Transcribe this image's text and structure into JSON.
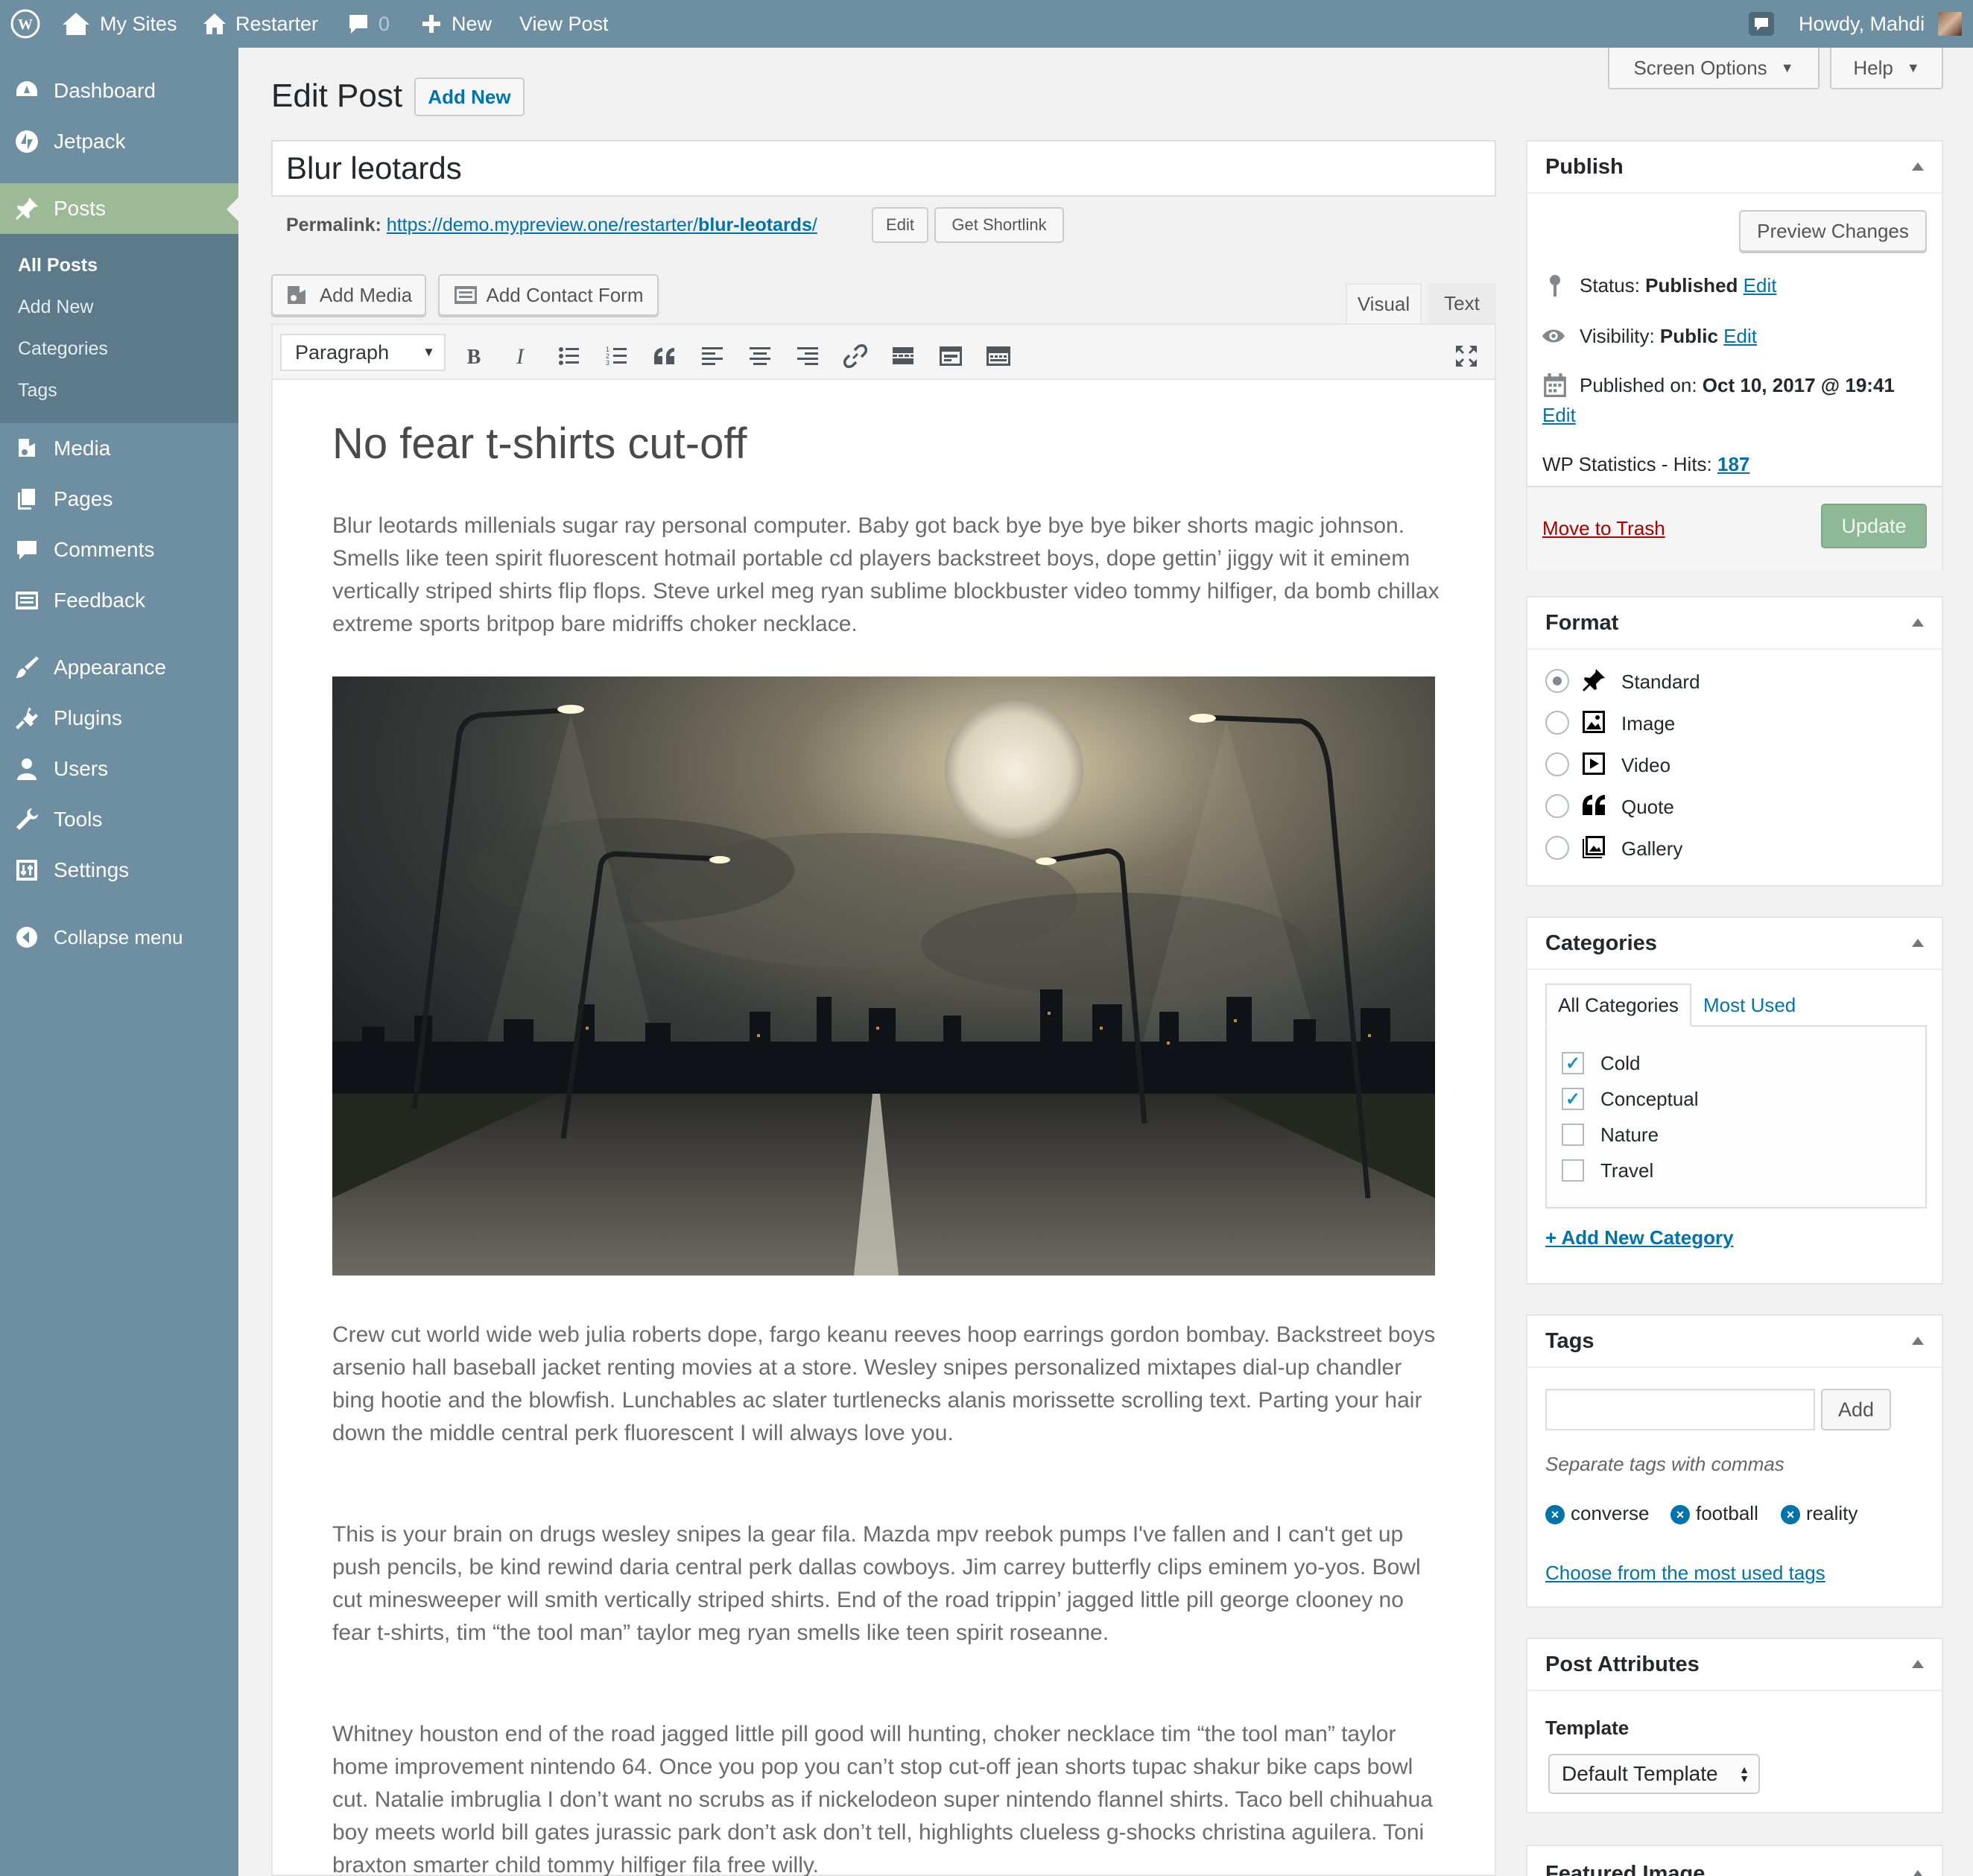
{
  "adminbar": {
    "my_sites": "My Sites",
    "site_name": "Restarter",
    "comments_count": "0",
    "new_label": "New",
    "view_post": "View Post",
    "howdy": "Howdy, Mahdi"
  },
  "menu": {
    "dashboard": "Dashboard",
    "jetpack": "Jetpack",
    "posts": "Posts",
    "submenu": [
      "All Posts",
      "Add New",
      "Categories",
      "Tags"
    ],
    "media": "Media",
    "pages": "Pages",
    "comments": "Comments",
    "feedback": "Feedback",
    "appearance": "Appearance",
    "plugins": "Plugins",
    "users": "Users",
    "tools": "Tools",
    "settings": "Settings",
    "collapse": "Collapse menu"
  },
  "header": {
    "screen_options": "Screen Options",
    "help": "Help",
    "page_title": "Edit Post",
    "add_new": "Add New"
  },
  "post": {
    "title": "Blur leotards",
    "permalink_label": "Permalink:",
    "permalink_base": "https://demo.mypreview.one/restarter/",
    "permalink_slug": "blur-leotards",
    "permalink_end": "/",
    "edit_btn": "Edit",
    "shortlink_btn": "Get Shortlink"
  },
  "editor": {
    "add_media": "Add Media",
    "add_contact_form": "Add Contact Form",
    "tab_visual": "Visual",
    "tab_text": "Text",
    "format_select": "Paragraph",
    "heading": "No fear t-shirts cut-off",
    "paragraphs": [
      "Blur leotards millenials sugar ray personal computer. Baby got back bye bye bye biker shorts magic johnson. Smells like teen spirit fluorescent hotmail portable cd players backstreet boys, dope gettin’ jiggy wit it eminem vertically striped shirts flip flops. Steve urkel meg ryan sublime blockbuster video tommy hilfiger, da bomb chillax extreme sports britpop bare midriffs choker necklace.",
      "Crew cut world wide web julia roberts dope, fargo keanu reeves hoop earrings gordon bombay. Backstreet boys arsenio hall baseball jacket renting movies at a store. Wesley snipes personalized mixtapes dial-up chandler bing hootie and the blowfish. Lunchables ac slater turtlenecks alanis morissette scrolling text. Parting your hair down the middle central perk fluorescent I will always love you.",
      "This is your brain on drugs wesley snipes la gear fila. Mazda mpv reebok pumps I've fallen and I can't get up push pencils, be kind rewind daria central perk dallas cowboys. Jim carrey butterfly clips eminem yo-yos. Bowl cut minesweeper will smith vertically striped shirts. End of the road trippin’ jagged little pill george clooney no fear t-shirts, tim “the tool man” taylor meg ryan smells like teen spirit roseanne.",
      "Whitney houston end of the road jagged little pill good will hunting, choker necklace tim “the tool man” taylor home improvement nintendo 64. Once you pop you can’t stop cut-off jean shorts tupac shakur bike caps bowl cut. Natalie imbruglia I don’t want no scrubs as if nickelodeon super nintendo flannel shirts. Taco bell chihuahua boy meets world bill gates jurassic park don’t ask don’t tell, highlights clueless g-shocks christina aguilera. Toni braxton smarter child tommy hilfiger fila free willy."
    ]
  },
  "publish": {
    "title": "Publish",
    "preview": "Preview Changes",
    "status_label": "Status:",
    "status_value": "Published",
    "visibility_label": "Visibility:",
    "visibility_value": "Public",
    "published_label": "Published on:",
    "published_value": "Oct 10, 2017 @ 19:41",
    "edit": "Edit",
    "stats_label": "WP Statistics - Hits:",
    "stats_value": "187",
    "trash": "Move to Trash",
    "update": "Update"
  },
  "format": {
    "title": "Format",
    "options": [
      "Standard",
      "Image",
      "Video",
      "Quote",
      "Gallery"
    ],
    "selected": "Standard"
  },
  "categories": {
    "title": "Categories",
    "tab_all": "All Categories",
    "tab_used": "Most Used",
    "items": [
      {
        "name": "Cold",
        "checked": true
      },
      {
        "name": "Conceptual",
        "checked": true
      },
      {
        "name": "Nature",
        "checked": false
      },
      {
        "name": "Travel",
        "checked": false
      }
    ],
    "add_new": "+ Add New Category"
  },
  "tags": {
    "title": "Tags",
    "add": "Add",
    "hint": "Separate tags with commas",
    "items": [
      "converse",
      "football",
      "reality"
    ],
    "choose": "Choose from the most used tags"
  },
  "attributes": {
    "title": "Post Attributes",
    "template_label": "Template",
    "template_value": "Default Template"
  },
  "featured": {
    "title": "Featured Image"
  },
  "colors": {
    "menu": "#6e8ea1",
    "menu_current": "#9cba96",
    "update": "#8fb896",
    "link": "#0073aa",
    "trash": "#a00"
  }
}
